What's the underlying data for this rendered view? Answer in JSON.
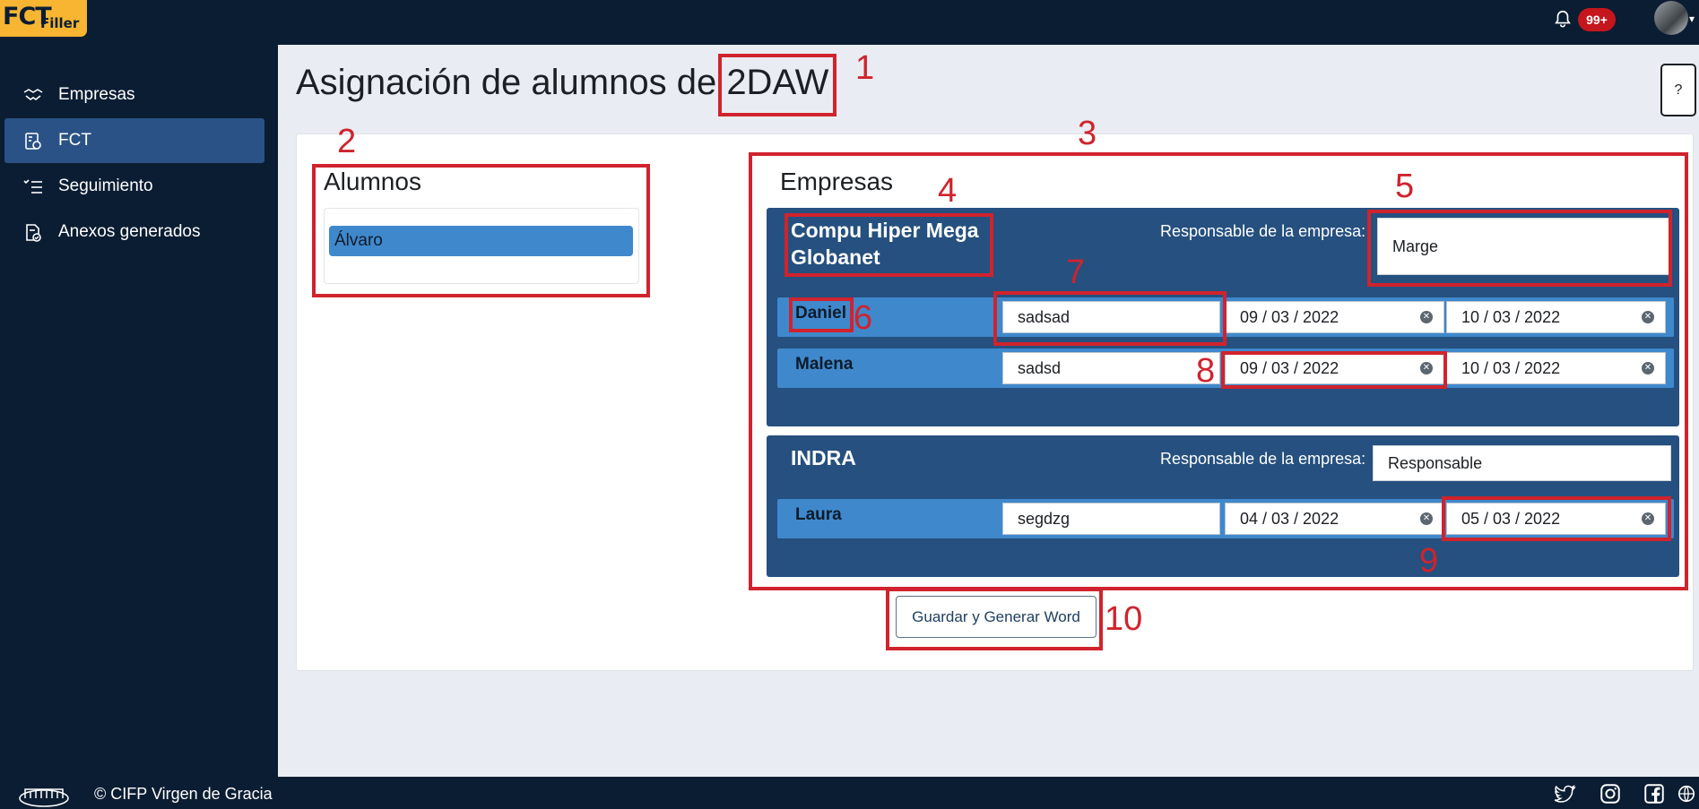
{
  "header": {
    "logo_big": "FCT",
    "logo_small": "Filler",
    "notifications_badge": "99+"
  },
  "sidebar": {
    "items": [
      {
        "label": "Empresas"
      },
      {
        "label": "FCT"
      },
      {
        "label": "Seguimiento"
      },
      {
        "label": "Anexos generados"
      }
    ]
  },
  "page": {
    "title_prefix": "Asignación de alumnos de ",
    "group": "2DAW",
    "help_label": "?"
  },
  "alumnos": {
    "title": "Alumnos",
    "items": [
      "Álvaro"
    ]
  },
  "empresas": {
    "title": "Empresas",
    "companies": [
      {
        "name": "Compu Hiper Mega Globanet",
        "resp_label": "Responsable de la empresa:",
        "resp_value": "Marge",
        "students": [
          {
            "name": "Daniel",
            "text": "sadsad",
            "start": "09 / 03 / 2022",
            "end": "10 / 03 / 2022"
          },
          {
            "name": "Malena",
            "text": "sadsd",
            "start": "09 / 03 / 2022",
            "end": "10 / 03 / 2022"
          }
        ]
      },
      {
        "name": "INDRA",
        "resp_label": "Responsable de la empresa:",
        "resp_value": "Responsable",
        "students": [
          {
            "name": "Laura",
            "text": "segdzg",
            "start": "04 / 03 / 2022",
            "end": "05 / 03 / 2022"
          }
        ]
      }
    ]
  },
  "actions": {
    "save_label": "Guardar y Generar Word"
  },
  "footer": {
    "copyright": "© CIFP Virgen de Gracia"
  },
  "annotations": [
    "1",
    "2",
    "3",
    "4",
    "5",
    "6",
    "7",
    "8",
    "9",
    "10"
  ],
  "colors": {
    "nav_bg": "#0b1d33",
    "company_bg": "#25507f",
    "student_bg": "#3f88cc",
    "annotation_red": "#d0232d"
  }
}
